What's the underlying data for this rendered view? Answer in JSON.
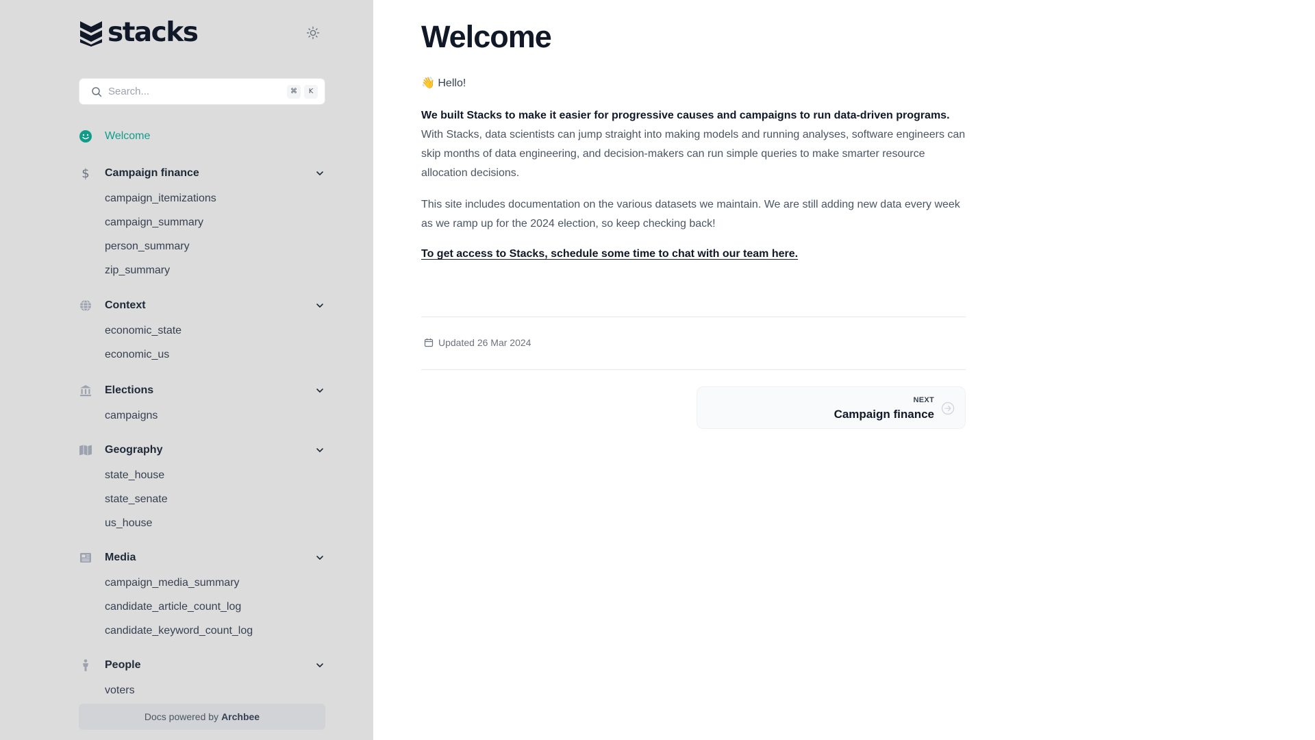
{
  "app": {
    "logo_text": "stacks"
  },
  "search": {
    "placeholder": "Search...",
    "shortcut_cmd": "⌘",
    "shortcut_key": "K"
  },
  "sidebar": {
    "welcome": "Welcome",
    "sections": [
      {
        "label": "Campaign finance",
        "icon": "dollar-icon",
        "items": [
          "campaign_itemizations",
          "campaign_summary",
          "person_summary",
          "zip_summary"
        ]
      },
      {
        "label": "Context",
        "icon": "globe-icon",
        "items": [
          "economic_state",
          "economic_us"
        ]
      },
      {
        "label": "Elections",
        "icon": "bank-icon",
        "items": [
          "campaigns"
        ]
      },
      {
        "label": "Geography",
        "icon": "map-icon",
        "items": [
          "state_house",
          "state_senate",
          "us_house"
        ]
      },
      {
        "label": "Media",
        "icon": "newspaper-icon",
        "items": [
          "campaign_media_summary",
          "candidate_article_count_log",
          "candidate_keyword_count_log"
        ]
      },
      {
        "label": "People",
        "icon": "person-icon",
        "items": [
          "voters"
        ]
      }
    ],
    "footer_prefix": "Docs powered by",
    "footer_brand": "Archbee"
  },
  "main": {
    "title": "Welcome",
    "hello_emoji": "👋",
    "hello": "Hello!",
    "intro_bold": "We built Stacks to make it easier for progressive causes and campaigns to run data-driven programs.",
    "intro_text": "With Stacks, data scientists can jump straight into making models and running analyses, software engineers can skip months of data engineering, and decision-makers can run simple queries to make smarter resource allocation decisions.",
    "paragraph2": "This site includes documentation on the various datasets we maintain. We are still adding new data every week as we ramp up for the 2024 election, so keep checking back!",
    "cta_link": "To get access to Stacks, schedule some time to chat with our team here.",
    "updated": "Updated 26 Mar 2024",
    "next_label": "NEXT",
    "next_title": "Campaign finance"
  },
  "colors": {
    "accent": "#0f9d8a",
    "sidebar_bg": "#dcdcdd"
  }
}
